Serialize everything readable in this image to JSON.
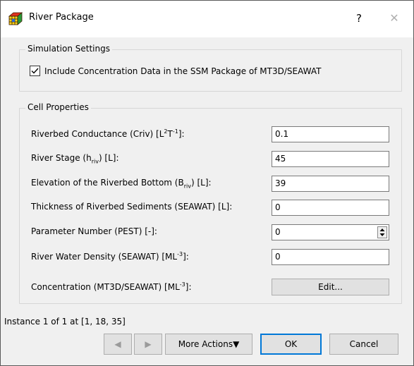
{
  "window": {
    "title": "River Package",
    "help_label": "?",
    "close_label": "✕"
  },
  "simulation_settings": {
    "group_title": "Simulation Settings",
    "checkbox_label": "Include Concentration Data in the SSM Package of MT3D/SEAWAT",
    "checked": true
  },
  "cell_properties": {
    "group_title": "Cell Properties",
    "riverbed_conductance": {
      "label_main": "Riverbed Conductance (Criv) [L",
      "sup1": "2",
      "mid": "T",
      "sup2": "-1",
      "end": "]:",
      "value": "0.1"
    },
    "river_stage": {
      "label_main": "River Stage (h",
      "sub": "riv",
      "end": ") [L]:",
      "value": "45"
    },
    "riverbed_bottom": {
      "label_main": "Elevation of the Riverbed Bottom (B",
      "sub": "riv",
      "end": ") [L]:",
      "value": "39"
    },
    "sediment_thickness": {
      "label": "Thickness of Riverbed Sediments (SEAWAT) [L]:",
      "value": "0"
    },
    "parameter_number": {
      "label": "Parameter Number (PEST) [-]:",
      "value": "0"
    },
    "water_density": {
      "label_main": "River Water Density (SEAWAT) [ML",
      "sup": "-3",
      "end": "]:",
      "value": "0"
    },
    "concentration": {
      "label_main": "Concentration (MT3D/SEAWAT) [ML",
      "sup": "-3",
      "end": "]:",
      "button_label": "Edit..."
    }
  },
  "status": {
    "instance_text": "Instance 1 of 1 at [1, 18, 35]"
  },
  "buttons": {
    "prev": "◀",
    "next": "▶",
    "more_actions": "More Actions▼",
    "ok": "OK",
    "cancel": "Cancel"
  }
}
